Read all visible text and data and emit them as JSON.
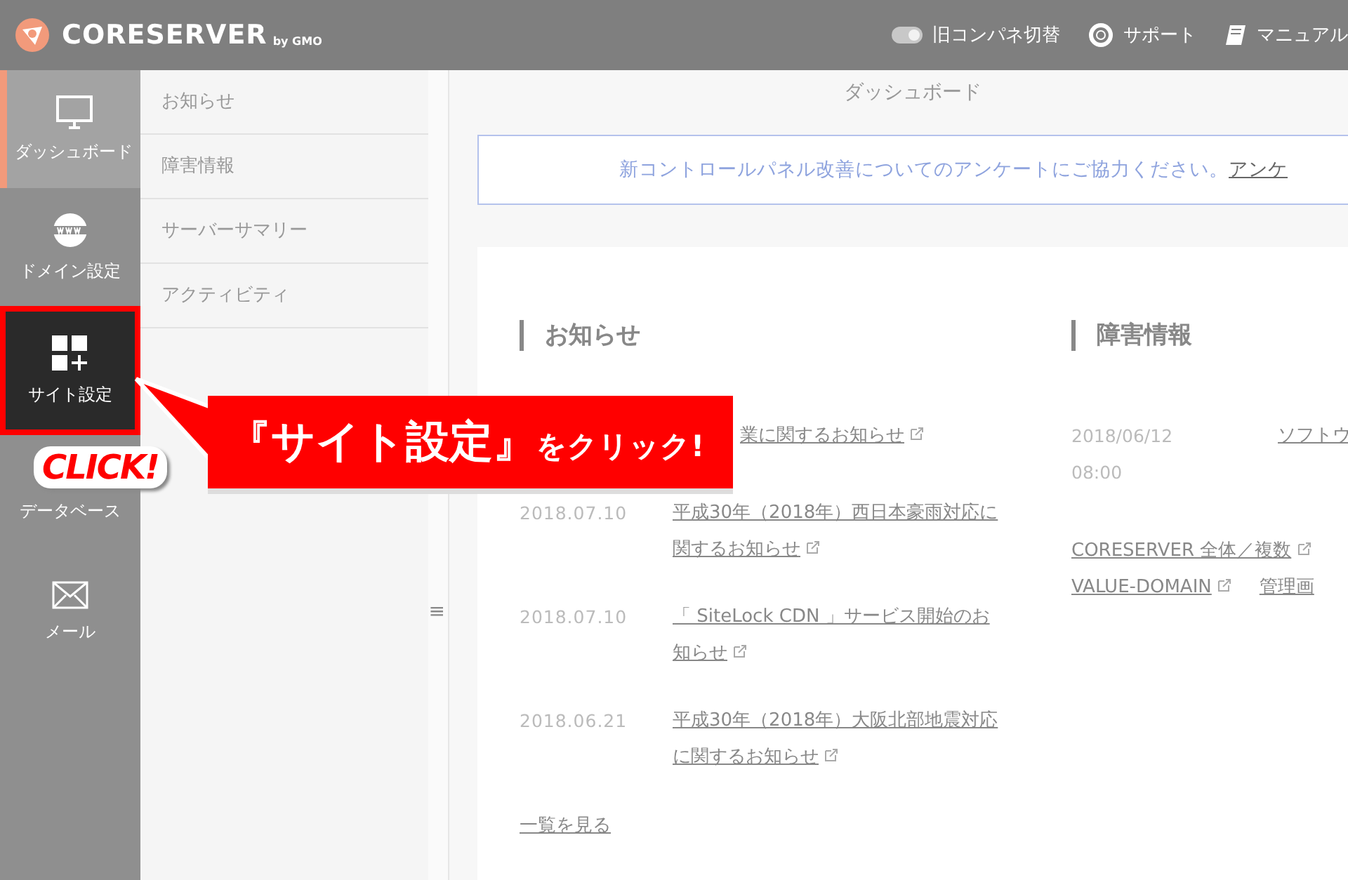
{
  "header": {
    "brand": "CORESERVER",
    "brand_suffix": "by GMO",
    "actions": [
      {
        "kind": "toggle",
        "label": "旧コンパネ切替",
        "on": true
      },
      {
        "kind": "support",
        "label": "サポート"
      },
      {
        "kind": "manual",
        "label": "マニュアル"
      }
    ]
  },
  "sidebar": {
    "items": [
      {
        "label": "ダッシュボード",
        "selected": true,
        "highlighted": false
      },
      {
        "label": "ドメイン設定",
        "selected": false,
        "highlighted": false
      },
      {
        "label": "サイト設定",
        "selected": false,
        "highlighted": true
      },
      {
        "label": "データベース",
        "selected": false,
        "highlighted": false
      },
      {
        "label": "メール",
        "selected": false,
        "highlighted": false
      }
    ]
  },
  "subnav": {
    "items": [
      "お知らせ",
      "障害情報",
      "サーバーサマリー",
      "アクティビティ"
    ],
    "toggle": "≡"
  },
  "page_title": "ダッシュボード",
  "banner": {
    "text": "新コントロールパネル改善についてのアンケートにご協力ください。",
    "link": "アンケ"
  },
  "news": {
    "title": "お知らせ",
    "items": [
      {
        "kind": "cut",
        "title": "業に関するお知らせ"
      },
      {
        "kind": "full",
        "date": "2018.07.10",
        "title": "平成30年（2018年）西日本豪雨対応に関するお知らせ"
      },
      {
        "kind": "full",
        "date": "2018.07.10",
        "title": "「 SiteLock CDN 」サービス開始のお知らせ"
      },
      {
        "kind": "full",
        "date": "2018.06.21",
        "title": "平成30年（2018年）大阪北部地震対応に関するお知らせ"
      }
    ],
    "more": "一覧を見る"
  },
  "incidents": {
    "title": "障害情報",
    "date": "2018/06/12",
    "time": "08:00",
    "link": "ソフトウ",
    "status_links": [
      "CORESERVER 全体／複数",
      "VALUE-DOMAIN"
    ],
    "extra_link": "管理画"
  },
  "callout": {
    "emphasis": "『サイト設定』",
    "rest": "をクリック!",
    "sticker": "CLICK!"
  }
}
